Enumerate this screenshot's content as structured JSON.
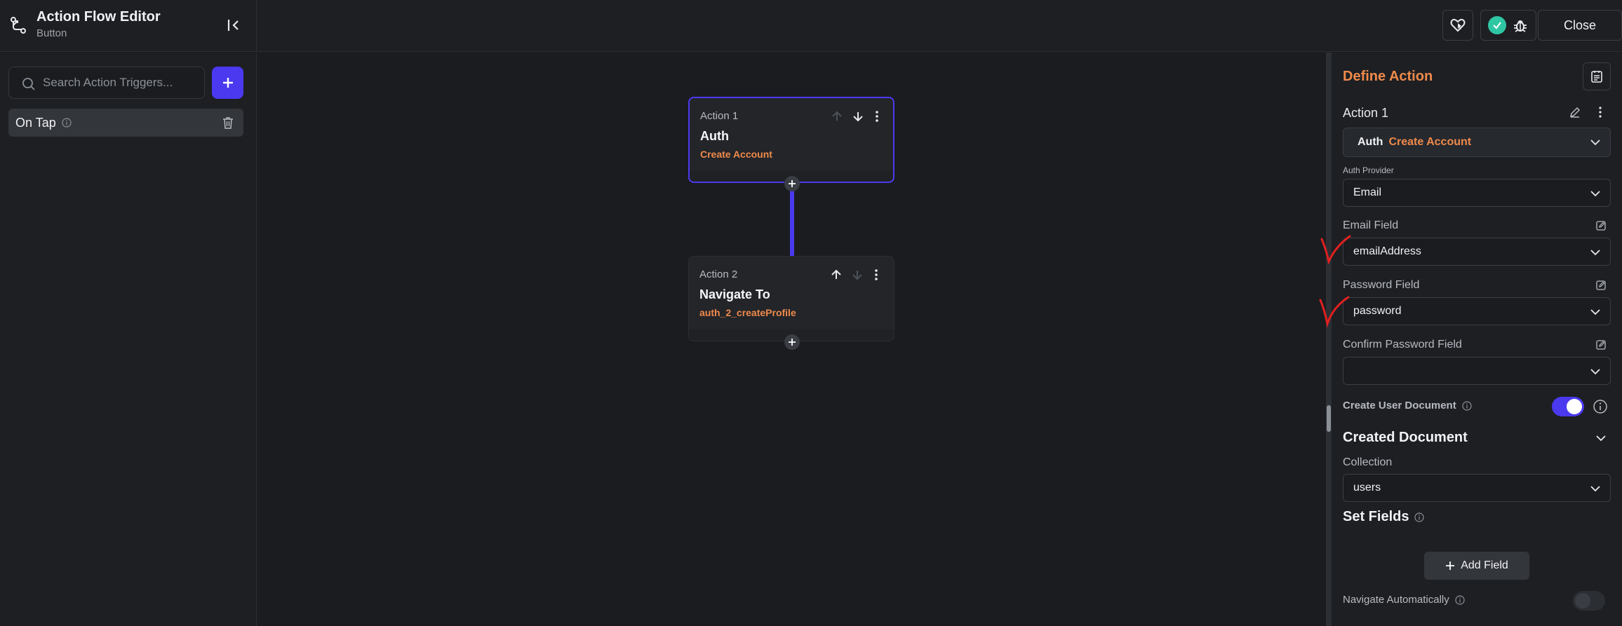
{
  "header": {
    "title": "Action Flow Editor",
    "subtitle": "Button",
    "close_label": "Close"
  },
  "left": {
    "search_placeholder": "Search Action Triggers...",
    "trigger_label": "On Tap"
  },
  "canvas": {
    "actions": [
      {
        "step": "Action 1",
        "name": "Auth",
        "sub": "Create Account"
      },
      {
        "step": "Action 2",
        "name": "Navigate To",
        "sub": "auth_2_createProfile"
      }
    ]
  },
  "panel": {
    "title": "Define Action",
    "action_label": "Action 1",
    "action_type": "Auth",
    "action_subtype": "Create Account",
    "auth_provider_label": "Auth Provider",
    "auth_provider_value": "Email",
    "email_field_label": "Email Field",
    "email_field_value": "emailAddress",
    "password_field_label": "Password Field",
    "password_field_value": "password",
    "confirm_password_label": "Confirm Password Field",
    "confirm_password_value": "",
    "create_user_doc_label": "Create User Document",
    "create_user_doc_enabled": true,
    "created_document_title": "Created Document",
    "collection_label": "Collection",
    "collection_value": "users",
    "set_fields_title": "Set Fields",
    "add_field_label": "Add Field",
    "navigate_auto_label": "Navigate Automatically",
    "navigate_auto_enabled": false
  },
  "colors": {
    "accent": "#4b39ef",
    "orange": "#ef8a4b",
    "success": "#2fc6a3",
    "annotation": "#e02020"
  }
}
